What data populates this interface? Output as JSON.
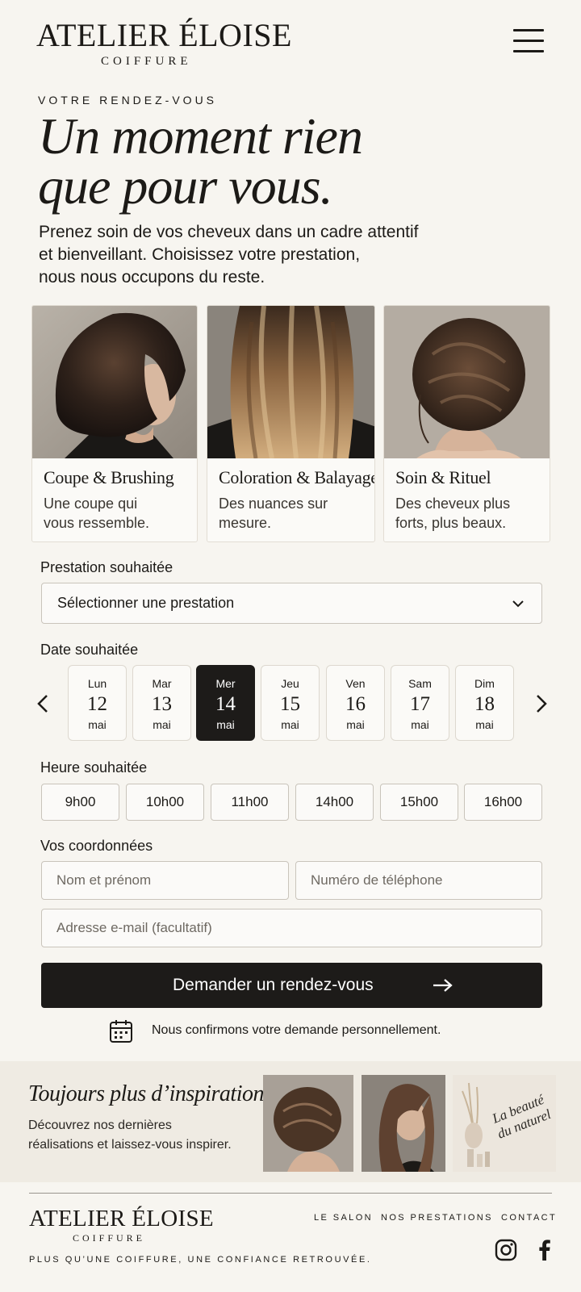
{
  "header": {
    "logo_main": "ATELIER ÉLOISE",
    "logo_sub": "COIFFURE",
    "menu_icon": "hamburger-icon"
  },
  "hero": {
    "eyebrow": "VOTRE RENDEZ-VOUS",
    "title_line1": "Un moment rien",
    "title_line2": "que pour vous.",
    "text_line1": "Prenez soin de vos cheveux dans un cadre attentif",
    "text_line2": "et bienveillant. Choisissez votre prestation,",
    "text_line3": "nous nous occupons du reste."
  },
  "services": [
    {
      "title": "Coupe & Brushing",
      "desc_line1": "Une coupe qui",
      "desc_line2": "vous ressemble."
    },
    {
      "title": "Coloration & Balayage",
      "desc_line1": "Des nuances sur",
      "desc_line2": "mesure."
    },
    {
      "title": "Soin & Rituel",
      "desc_line1": "Des cheveux plus",
      "desc_line2": "forts, plus beaux."
    }
  ],
  "form": {
    "service_label": "Prestation souhaitée",
    "service_select_value": "Sélectionner une prestation",
    "date_label": "Date souhaitée",
    "days": [
      {
        "name": "Lun",
        "date": "12",
        "month": "mai"
      },
      {
        "name": "Mar",
        "date": "13",
        "month": "mai"
      },
      {
        "name": "Mer",
        "date": "14",
        "month": "mai"
      },
      {
        "name": "Jeu",
        "date": "15",
        "month": "mai"
      },
      {
        "name": "Ven",
        "date": "16",
        "month": "mai"
      },
      {
        "name": "Sam",
        "date": "17",
        "month": "mai"
      },
      {
        "name": "Dim",
        "date": "18",
        "month": "mai"
      }
    ],
    "selected_day": "14",
    "time_label": "Heure souhaitée",
    "times": [
      "9h00",
      "10h00",
      "11h00",
      "14h00",
      "15h00",
      "16h00"
    ],
    "contact_label": "Vos coordonnées",
    "name_placeholder": "Nom et prénom",
    "phone_placeholder": "Numéro de téléphone",
    "email_placeholder": "Adresse e-mail (facultatif)",
    "submit_label": "Demander un rendez-vous",
    "confirm_text": "Nous confirmons votre demande personnellement."
  },
  "inspiration": {
    "title": "Toujours plus d’inspirations",
    "text_line1": "Découvrez nos dernières",
    "text_line2": "réalisations et laissez-vous inspirer.",
    "card_script_line1": "La beauté",
    "card_script_line2": "du naturel"
  },
  "footer": {
    "logo_main": "ATELIER ÉLOISE",
    "logo_sub": "COIFFURE",
    "tagline": "PLUS QU’UNE COIFFURE, UNE CONFIANCE RETROUVÉE.",
    "links": [
      "LE SALON",
      "NOS PRESTATIONS",
      "CONTACT"
    ]
  },
  "colors": {
    "background": "#f7f5f0",
    "text": "#1c1a17",
    "accent_dark": "#1d1b19",
    "border": "#c9c4bb"
  }
}
